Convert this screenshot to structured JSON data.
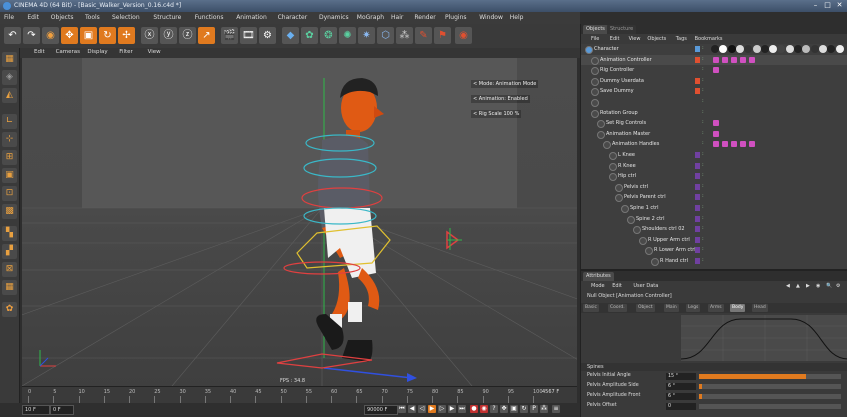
{
  "window": {
    "title": "CINEMA 4D (64 Bit) - [Basic_Walker_Version_0.16.c4d *]"
  },
  "menubar": [
    "File",
    "Edit",
    "Objects",
    "Tools",
    "Selection",
    "Structure",
    "Functions",
    "Animation",
    "Character",
    "Dynamics",
    "MoGraph",
    "Hair",
    "Render",
    "Plugins",
    "Window",
    "Help"
  ],
  "viewport": {
    "menu": [
      "Edit",
      "Cameras",
      "Display",
      "Filter",
      "View"
    ],
    "info": [
      "< Mode: Animation Mode",
      "< Animation: Enabled",
      "< Rig Scale   100 %"
    ],
    "fps": "FPS : 34.8"
  },
  "timeline": {
    "ticks": [
      "0",
      "5",
      "10",
      "15",
      "20",
      "25",
      "30",
      "35",
      "40",
      "45",
      "50",
      "55",
      "60",
      "65",
      "70",
      "75",
      "80",
      "85",
      "90",
      "95",
      "100"
    ],
    "current_frame_end": "4567 F"
  },
  "transport": {
    "start": "10 F",
    "range_start": "0 F",
    "range_end": "90000 F"
  },
  "objects_panel": {
    "tabs": [
      "Objects",
      "Structure"
    ],
    "menu": [
      "File",
      "Edit",
      "View",
      "Objects",
      "Tags",
      "Bookmarks"
    ],
    "items": [
      {
        "name": "Character",
        "indent": 0,
        "swatch": "#5a9ad8",
        "tags": 0
      },
      {
        "name": "Animation Controller",
        "indent": 1,
        "swatch": "#e05030",
        "tags": 5,
        "selected": true
      },
      {
        "name": "Rig Controller",
        "indent": 1,
        "swatch": "",
        "tags": 1
      },
      {
        "name": "Dummy Userdata",
        "indent": 1,
        "swatch": "#e05030",
        "tags": 0
      },
      {
        "name": "Save Dummy",
        "indent": 1,
        "swatch": "#e05030",
        "tags": 0
      },
      {
        "name": "",
        "indent": 1,
        "swatch": "",
        "tags": 0
      },
      {
        "name": "Rotation Group",
        "indent": 1,
        "swatch": "",
        "tags": 0
      },
      {
        "name": "Set Rig Controls",
        "indent": 2,
        "swatch": "",
        "tags": 1
      },
      {
        "name": "Animation Master",
        "indent": 2,
        "swatch": "",
        "tags": 1
      },
      {
        "name": "Animation Handles",
        "indent": 3,
        "swatch": "",
        "tags": 5
      },
      {
        "name": "L Knee",
        "indent": 4,
        "swatch": "#7040a0",
        "tags": 0
      },
      {
        "name": "R Knee",
        "indent": 4,
        "swatch": "#7040a0",
        "tags": 0
      },
      {
        "name": "Hip ctrl",
        "indent": 4,
        "swatch": "#7040a0",
        "tags": 0
      },
      {
        "name": "Pelvis ctrl",
        "indent": 5,
        "swatch": "#7040a0",
        "tags": 0
      },
      {
        "name": "Pelvis Parent ctrl",
        "indent": 5,
        "swatch": "#7040a0",
        "tags": 0
      },
      {
        "name": "Spine 1 ctrl",
        "indent": 6,
        "swatch": "#7040a0",
        "tags": 0
      },
      {
        "name": "Spine 2 ctrl",
        "indent": 7,
        "swatch": "#7040a0",
        "tags": 0
      },
      {
        "name": "Shoulders ctrl 02",
        "indent": 8,
        "swatch": "#7040a0",
        "tags": 0
      },
      {
        "name": "R Upper Arm ctrl",
        "indent": 9,
        "swatch": "#7040a0",
        "tags": 0
      },
      {
        "name": "R Lower Arm ctrl",
        "indent": 10,
        "swatch": "#7040a0",
        "tags": 0
      },
      {
        "name": "R Hand ctrl",
        "indent": 11,
        "swatch": "#7040a0",
        "tags": 0
      }
    ]
  },
  "attributes_panel": {
    "title": "Attributes",
    "menu": [
      "Mode",
      "Edit",
      "User Data"
    ],
    "object": "Null Object [Animation Controller]",
    "tabs": [
      "Basic",
      "Coord.",
      "Object",
      "Main",
      "Legs",
      "Arms",
      "Body",
      "Head"
    ],
    "active_tab": "Body",
    "section": "Spines",
    "params": [
      {
        "label": "Pelvis Initial Angle",
        "value": "15 °",
        "fill": 0.75
      },
      {
        "label": "Pelvis Amplitude Side",
        "value": "6 °",
        "fill": 0.02
      },
      {
        "label": "Pelvis Amplitude Front",
        "value": "6 °",
        "fill": 0.02
      },
      {
        "label": "Pelvis Offset",
        "value": "0",
        "fill": 0.0
      }
    ]
  }
}
